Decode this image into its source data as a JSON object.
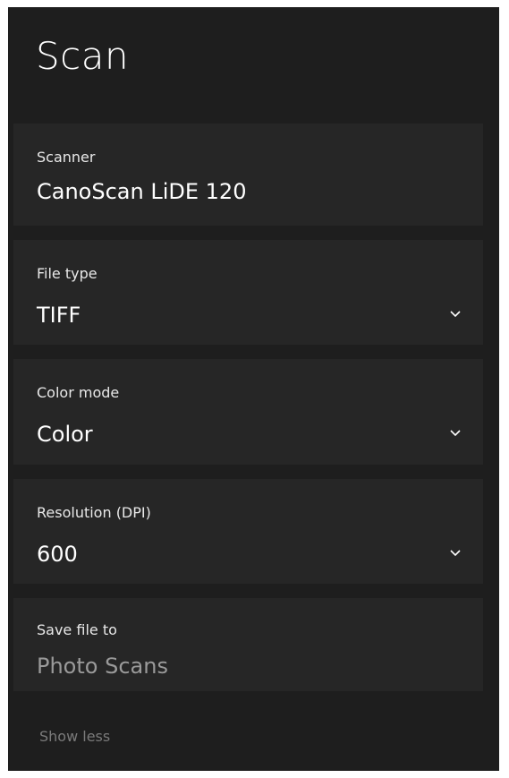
{
  "page": {
    "title": "Scan"
  },
  "scanner": {
    "label": "Scanner",
    "value": "CanoScan LiDE 120"
  },
  "file_type": {
    "label": "File type",
    "value": "TIFF",
    "icon": "chevron-down-icon"
  },
  "color_mode": {
    "label": "Color mode",
    "value": "Color",
    "icon": "chevron-down-icon"
  },
  "resolution": {
    "label": "Resolution (DPI)",
    "value": "600",
    "icon": "chevron-down-icon"
  },
  "save_to": {
    "label": "Save file to",
    "value": "Photo Scans"
  },
  "show_less": {
    "label": "Show less"
  },
  "colors": {
    "background": "#1e1e1e",
    "card": "#262626",
    "text": "#ffffff",
    "muted": "#9a9a9a"
  }
}
